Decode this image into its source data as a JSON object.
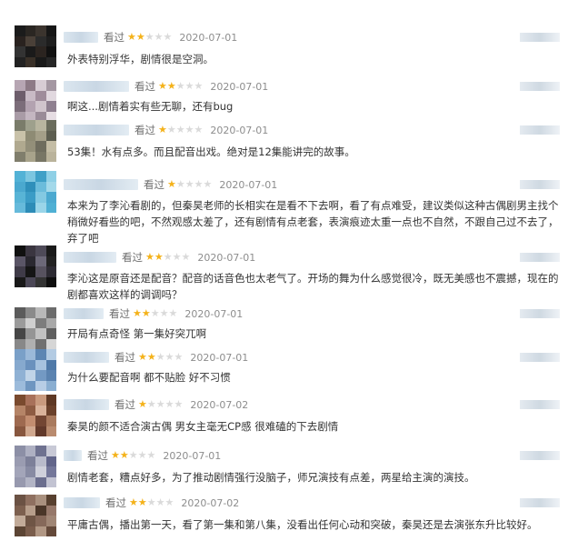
{
  "reviews": [
    {
      "watched": "看过",
      "rating": 2,
      "date": "2020-07-01",
      "text": "外表特别浮华，剧情很是空洞。"
    },
    {
      "watched": "看过",
      "rating": 2,
      "date": "2020-07-01",
      "text": "啊这...剧情着实有些无聊，还有bug"
    },
    {
      "watched": "看过",
      "rating": 1,
      "date": "2020-07-01",
      "text": "53集！水有点多。而且配音出戏。绝对是12集能讲完的故事。"
    },
    {
      "watched": "看过",
      "rating": 1,
      "date": "2020-07-01",
      "text": "本来为了李沁看剧的，但秦昊老师的长相实在是看不下去啊，看了有点难受，建议类似这种古偶剧男主找个稍微好看些的吧，不然观感太差了，还有剧情有点老套，表演痕迹太重一点也不自然，不跟自己过不去了，弃了吧"
    },
    {
      "watched": "看过",
      "rating": 2,
      "date": "2020-07-01",
      "text": "李沁这是原音还是配音？配音的话音色也太老气了。开场的舞为什么感觉很冷，既无美感也不震撼，现在的剧都喜欢这样的调调吗？"
    },
    {
      "watched": "看过",
      "rating": 2,
      "date": "2020-07-01",
      "text": "开局有点奇怪 第一集好突兀啊"
    },
    {
      "watched": "看过",
      "rating": 2,
      "date": "2020-07-01",
      "text": "为什么要配音啊 都不贴脸 好不习惯"
    },
    {
      "watched": "看过",
      "rating": 1,
      "date": "2020-07-02",
      "text": "秦昊的颜不适合演古偶 男女主毫无CP感 很难磕的下去剧情"
    },
    {
      "watched": "看过",
      "rating": 2,
      "date": "2020-07-01",
      "text": "剧情老套，糟点好多，为了推动剧情强行没脑子，师兄演技有点差，两星给主演的演技。"
    },
    {
      "watched": "看过",
      "rating": 2,
      "date": "2020-07-02",
      "text": "平庸古偶，播出第一天，看了第一集和第八集，没看出任何心动和突破，秦昊还是去演张东升比较好。"
    }
  ],
  "colors": {
    "star_on": "#f4b21a",
    "star_off": "#dadada"
  }
}
